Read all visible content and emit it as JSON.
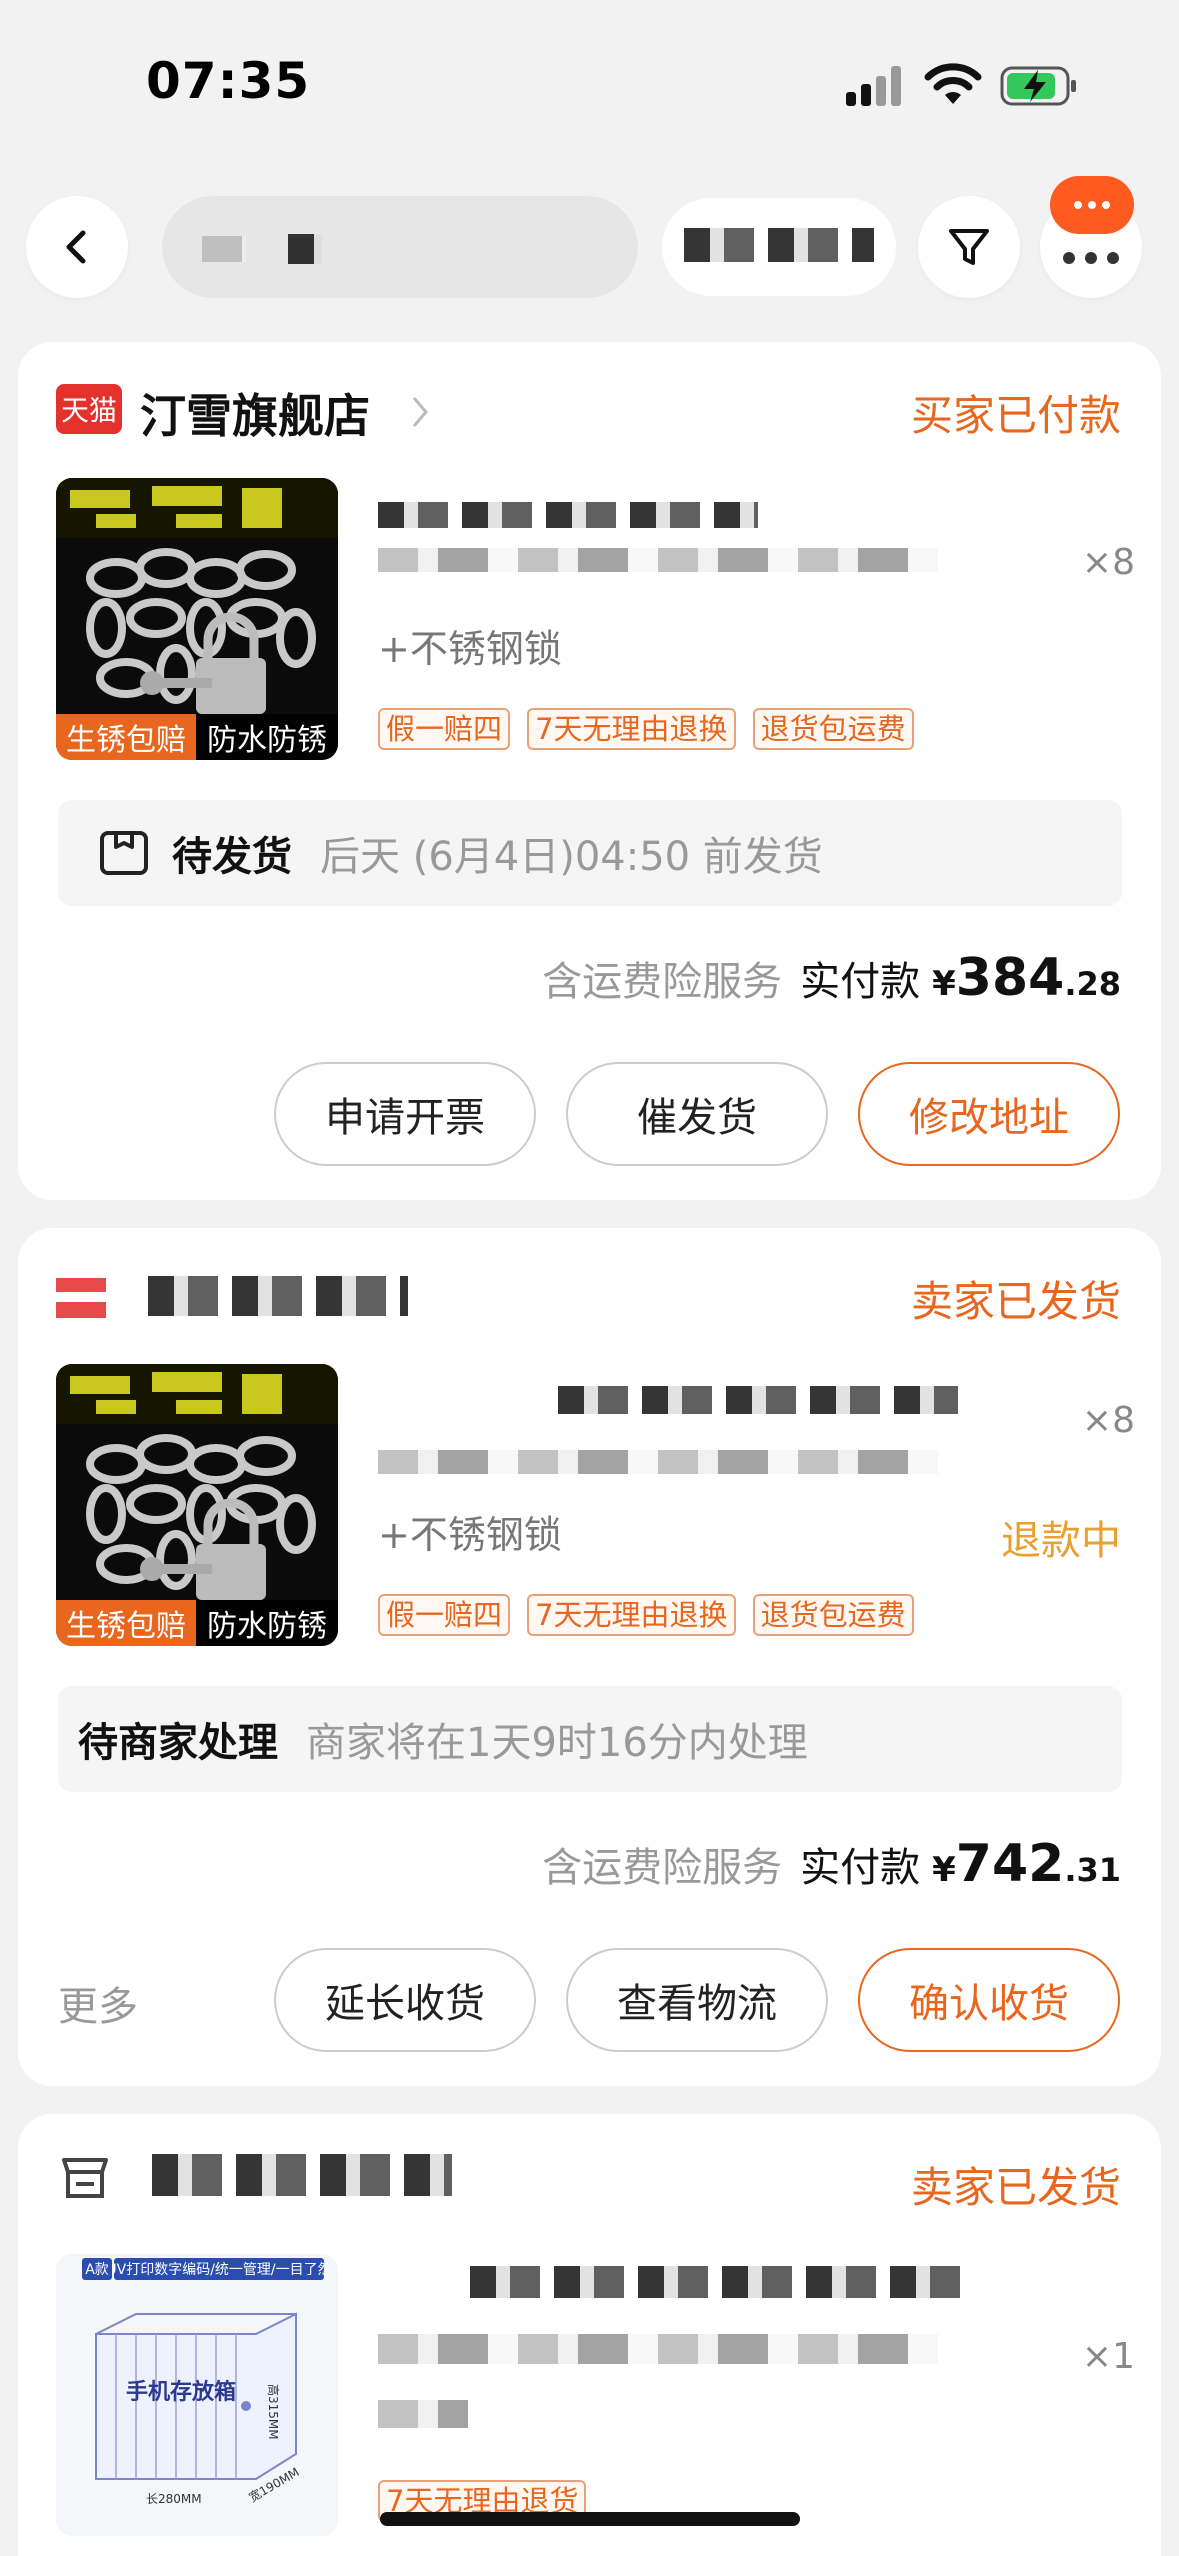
{
  "status_bar": {
    "time": "07:35"
  },
  "orders": [
    {
      "store_badge": "天猫",
      "shop_name": "汀雪旗舰店",
      "status": "买家已付款",
      "thumb_tags": [
        "生锈包赔",
        "防水防锈"
      ],
      "sku": "+不锈钢锁",
      "qty": "×8",
      "chips": [
        "假一赔四",
        "7天无理由退换",
        "退货包运费"
      ],
      "info_strong": "待发货",
      "info_weak": "后天 (6月4日)04:50 前发货",
      "price_label": "含运费险服务",
      "price_label2": "实付款",
      "price_symbol": "¥",
      "price_int": "384",
      "price_dec": ".28",
      "buttons": [
        "申请开票",
        "催发货",
        "修改地址"
      ]
    },
    {
      "status": "卖家已发货",
      "thumb_tags": [
        "生锈包赔",
        "防水防锈"
      ],
      "sku": "+不锈钢锁",
      "qty": "×8",
      "refund": "退款中",
      "chips": [
        "假一赔四",
        "7天无理由退换",
        "退货包运费"
      ],
      "info_strong": "待商家处理",
      "info_weak": "商家将在1天9时16分内处理",
      "price_label": "含运费险服务",
      "price_label2": "实付款",
      "price_symbol": "¥",
      "price_int": "742",
      "price_dec": ".31",
      "more": "更多",
      "buttons": [
        "延长收货",
        "查看物流",
        "确认收货"
      ]
    },
    {
      "status": "卖家已发货",
      "qty": "×1",
      "chips": [
        "7天无理由退货"
      ],
      "thumb": {
        "badge": "A款",
        "header": "UV打印数字编码/统一管理/一目了然",
        "caption": "手机存放箱",
        "dim_w": "长280MM",
        "dim_d": "宽190MM",
        "dim_h": "高315MM"
      }
    }
  ],
  "colors": {
    "accent": "#e8661d",
    "refund": "#e8a030",
    "badge": "#ff5a1f"
  }
}
